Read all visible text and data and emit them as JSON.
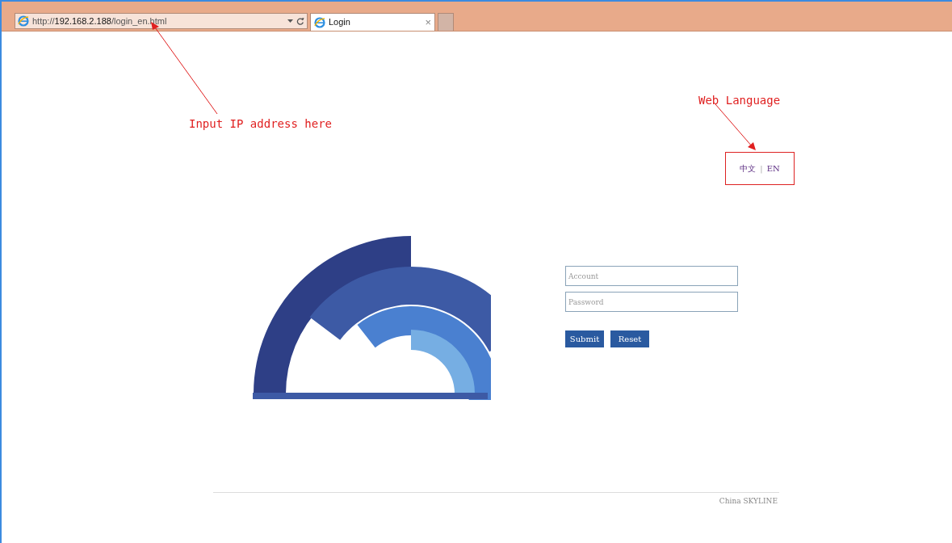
{
  "browser": {
    "url_scheme": "http://",
    "url_host": "192.168.2.188",
    "url_path": "/login_en.html",
    "tab": {
      "title": "Login",
      "close": "×"
    }
  },
  "language": {
    "options": [
      {
        "label": "中文"
      },
      {
        "label": "EN"
      }
    ],
    "separator": "|"
  },
  "login": {
    "account": {
      "placeholder": "Account"
    },
    "password": {
      "placeholder": "Password"
    },
    "buttons": [
      "Submit",
      "Reset"
    ]
  },
  "footer": "China SKYLINE",
  "annotations": [
    {
      "text": "Input IP address here"
    },
    {
      "text": "Web Language"
    }
  ]
}
